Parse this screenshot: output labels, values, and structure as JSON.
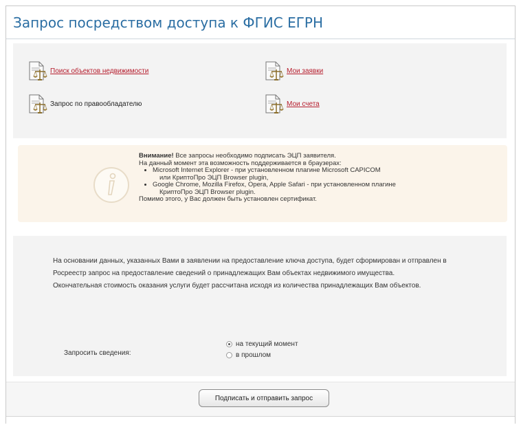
{
  "title": "Запрос посредством доступа к ФГИС ЕГРН",
  "links": {
    "search_objects": "Поиск объектов недвижимости",
    "my_requests": "Мои заявки",
    "by_rightholder": "Запрос по правообладателю",
    "my_invoices": "Мои счета"
  },
  "notice": {
    "bold": "Внимание!",
    "line1_rest": " Все запросы необходимо подписать ЭЦП заявителя.",
    "line2": "На данный момент эта возможность поддерживается в браузерах:",
    "bullets": [
      {
        "l1": "Microsoft Internet Explorer - при установленном плагине Microsoft CAPICOM",
        "l2": "или КриптоПро ЭЦП Browser plugin,"
      },
      {
        "l1": "Google Chrome, Mozilla Firefox, Opera, Apple Safari - при установленном плагине",
        "l2": "КриптоПро ЭЦП Browser plugin."
      }
    ],
    "line_last": "Помимо этого, у Вас должен быть установлен сертификат."
  },
  "description": {
    "p1": "На основании данных, указанных Вами в заявлении на предоставление ключа доступа, будет сформирован и отправлен в Росреестр запрос на предоставление сведений о принадлежащих Вам объектах недвижимого имущества.",
    "p2": "Окончательная стоимость оказания услуги будет рассчитана исходя из количества принадлежащих Вам объектов."
  },
  "request": {
    "label": "Запросить сведения:",
    "options": [
      {
        "label": "на текущий момент",
        "selected": true
      },
      {
        "label": "в прошлом",
        "selected": false
      }
    ]
  },
  "submit_label": "Подписать и отправить запрос",
  "colors": {
    "title": "#2b6ea3",
    "link": "#b51c2c",
    "notice_bg": "#fbf4ea",
    "panel_bg": "#f3f3f3"
  }
}
